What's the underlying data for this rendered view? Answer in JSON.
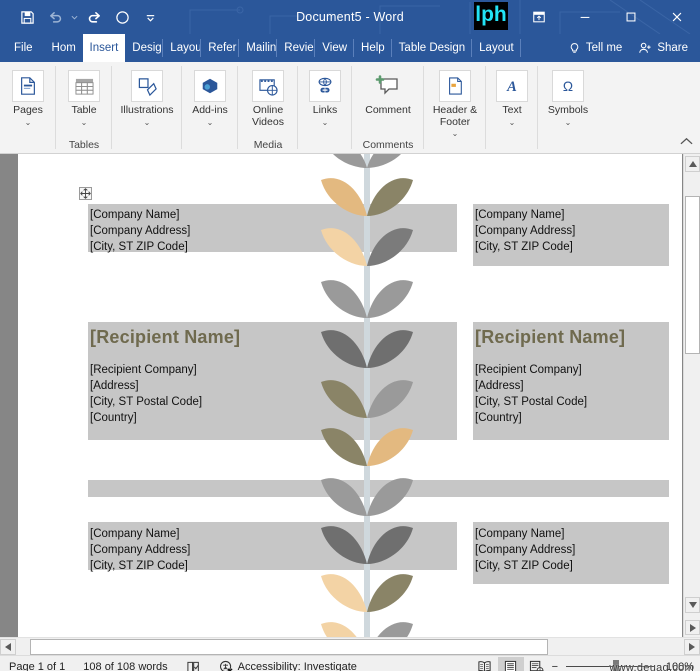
{
  "titlebar": {
    "document_title": "Document5  -  Word",
    "logo_text": "lph",
    "quick_access": [
      {
        "name": "save",
        "label": "Save",
        "icon": "save-icon"
      },
      {
        "name": "undo",
        "label": "Undo",
        "icon": "undo-icon"
      },
      {
        "name": "redo",
        "label": "Redo",
        "icon": "redo-icon"
      },
      {
        "name": "autosave",
        "label": "AutoSave",
        "icon": "circle-icon"
      },
      {
        "name": "customize",
        "label": "Customize Quick Access Toolbar",
        "icon": "chevron-down-icon"
      }
    ],
    "window_controls": [
      {
        "name": "ribbon-display-options",
        "label": "Ribbon Display Options",
        "icon": "ribbon-options-icon"
      },
      {
        "name": "minimize",
        "label": "Minimize",
        "icon": "minimize-icon"
      },
      {
        "name": "maximize",
        "label": "Maximize",
        "icon": "maximize-icon"
      },
      {
        "name": "close",
        "label": "Close",
        "icon": "close-icon"
      }
    ]
  },
  "tabs": {
    "items": [
      {
        "label": "File",
        "active": false
      },
      {
        "label": "Hom",
        "active": false
      },
      {
        "label": "Insert",
        "active": true
      },
      {
        "label": "Desig",
        "active": false
      },
      {
        "label": "Layou",
        "active": false
      },
      {
        "label": "Refer",
        "active": false
      },
      {
        "label": "Mailin",
        "active": false
      },
      {
        "label": "Revie",
        "active": false
      },
      {
        "label": "View",
        "active": false
      },
      {
        "label": "Help",
        "active": false
      },
      {
        "label": "Table Design",
        "active": false
      },
      {
        "label": "Layout",
        "active": false
      }
    ],
    "tell_me": "Tell me",
    "share": "Share"
  },
  "ribbon": {
    "groups": [
      {
        "name": "",
        "buttons": [
          {
            "label": "Pages",
            "icon": "pages-icon",
            "caret": true
          }
        ]
      },
      {
        "name": "Tables",
        "buttons": [
          {
            "label": "Table",
            "icon": "table-icon",
            "caret": true
          }
        ]
      },
      {
        "name": "",
        "buttons": [
          {
            "label": "Illustrations",
            "icon": "illustrations-icon",
            "caret": true
          }
        ]
      },
      {
        "name": "",
        "buttons": [
          {
            "label": "Add-ins",
            "icon": "addins-icon",
            "caret": true
          }
        ]
      },
      {
        "name": "Media",
        "buttons": [
          {
            "label": "Online Videos",
            "icon": "online-video-icon",
            "caret": false
          }
        ]
      },
      {
        "name": "",
        "buttons": [
          {
            "label": "Links",
            "icon": "links-icon",
            "caret": true
          }
        ]
      },
      {
        "name": "Comments",
        "buttons": [
          {
            "label": "Comment",
            "icon": "comment-icon",
            "caret": false
          }
        ]
      },
      {
        "name": "",
        "buttons": [
          {
            "label": "Header & Footer",
            "icon": "header-footer-icon",
            "caret": true
          }
        ]
      },
      {
        "name": "",
        "buttons": [
          {
            "label": "Text",
            "icon": "text-icon",
            "caret": true
          }
        ]
      },
      {
        "name": "",
        "buttons": [
          {
            "label": "Symbols",
            "icon": "symbols-icon",
            "caret": true
          }
        ]
      }
    ],
    "collapse_label": "Collapse the Ribbon"
  },
  "document": {
    "sender_left": {
      "line1": "[Company Name]",
      "line2": "[Company Address]",
      "line3": "[City, ST  ZIP Code]"
    },
    "sender_right": {
      "line1": "[Company Name]",
      "line2": "[Company Address]",
      "line3": "[City, ST  ZIP Code]"
    },
    "recipient_left": {
      "name": "[Recipient Name]",
      "line1": "[Recipient Company]",
      "line2": "[Address]",
      "line3": "[City, ST  Postal Code]",
      "line4": "[Country]"
    },
    "recipient_right": {
      "name": "[Recipient Name]",
      "line1": "[Recipient Company]",
      "line2": "[Address]",
      "line3": "[City, ST  Postal Code]",
      "line4": "[Country]"
    },
    "sender_left_bottom": {
      "line1": "[Company Name]",
      "line2": "[Company Address]",
      "line3": "[City, ST  ZIP Code]"
    },
    "sender_right_bottom": {
      "line1": "[Company Name]",
      "line2": "[Company Address]",
      "line3": "[City, ST  ZIP Code]"
    },
    "colors": {
      "selection_highlight": "#c6c6c6",
      "heading": "#6f6a4e",
      "leaf_gray": "#9a9a9a",
      "leaf_dark_gray": "#6f6f6f",
      "leaf_olive": "#8a8467",
      "leaf_tan": "#e3b980",
      "leaf_light_tan": "#f3d3a5"
    }
  },
  "statusbar": {
    "page": "Page 1 of 1",
    "words": "108 of 108 words",
    "proofing_icon": "proofing-icon",
    "accessibility": "Accessibility: Investigate",
    "views": [
      {
        "name": "read-mode",
        "label": "Read Mode",
        "selected": false
      },
      {
        "name": "print-layout",
        "label": "Print Layout",
        "selected": true
      },
      {
        "name": "web-layout",
        "label": "Web Layout",
        "selected": false
      }
    ],
    "zoom_out": "−",
    "zoom_in": "+",
    "zoom_percent": "100%"
  },
  "watermark": "www.deuaq.com"
}
